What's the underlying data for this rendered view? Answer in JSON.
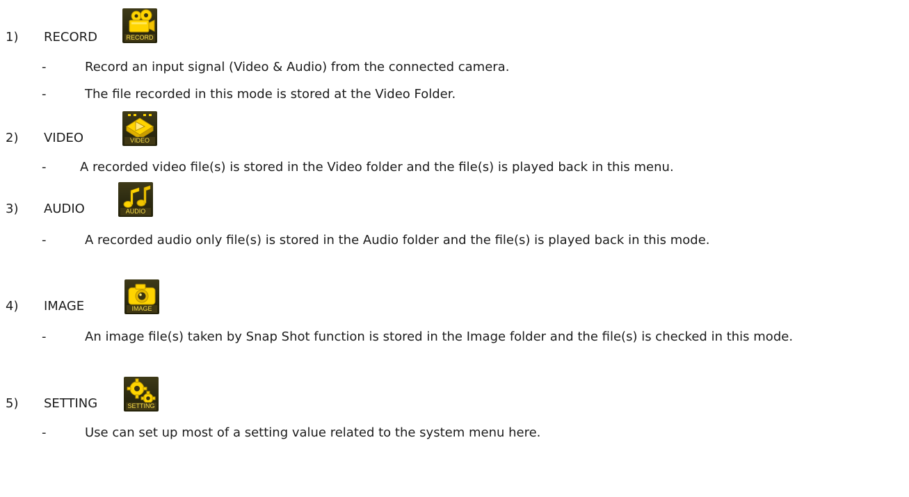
{
  "sections": [
    {
      "number": "1)",
      "title": "RECORD",
      "icon": {
        "name": "record-icon",
        "badge": "RECORD"
      },
      "bullets": [
        "Record an input signal (Video & Audio) from the connected camera.",
        "The file recorded in this mode is stored at the Video Folder."
      ]
    },
    {
      "number": "2)",
      "title": "VIDEO",
      "icon": {
        "name": "video-icon",
        "badge": "VIDEO"
      },
      "bullets": [
        "A recorded video file(s) is stored in the Video folder and the file(s) is played back in this menu."
      ]
    },
    {
      "number": "3)",
      "title": "AUDIO",
      "icon": {
        "name": "audio-icon",
        "badge": "AUDIO"
      },
      "bullets": [
        "A recorded audio only file(s) is stored in the Audio folder and the file(s) is played back in this mode."
      ]
    },
    {
      "number": "4)",
      "title": "IMAGE",
      "icon": {
        "name": "image-icon",
        "badge": "IMAGE"
      },
      "bullets": [
        "An image file(s) taken by Snap Shot function is stored in the Image folder and the file(s) is checked in this mode."
      ]
    },
    {
      "number": "5)",
      "title": "SETTING",
      "icon": {
        "name": "setting-icon",
        "badge": "SETTING"
      },
      "bullets": [
        "Use can set up most of a setting value related to the system menu here."
      ]
    }
  ],
  "dash": "-",
  "colors": {
    "icon_bg": "#2c2a10",
    "icon_yellow": "#ffd400",
    "icon_text": "#ffe34a",
    "text": "#1a1a1a"
  }
}
